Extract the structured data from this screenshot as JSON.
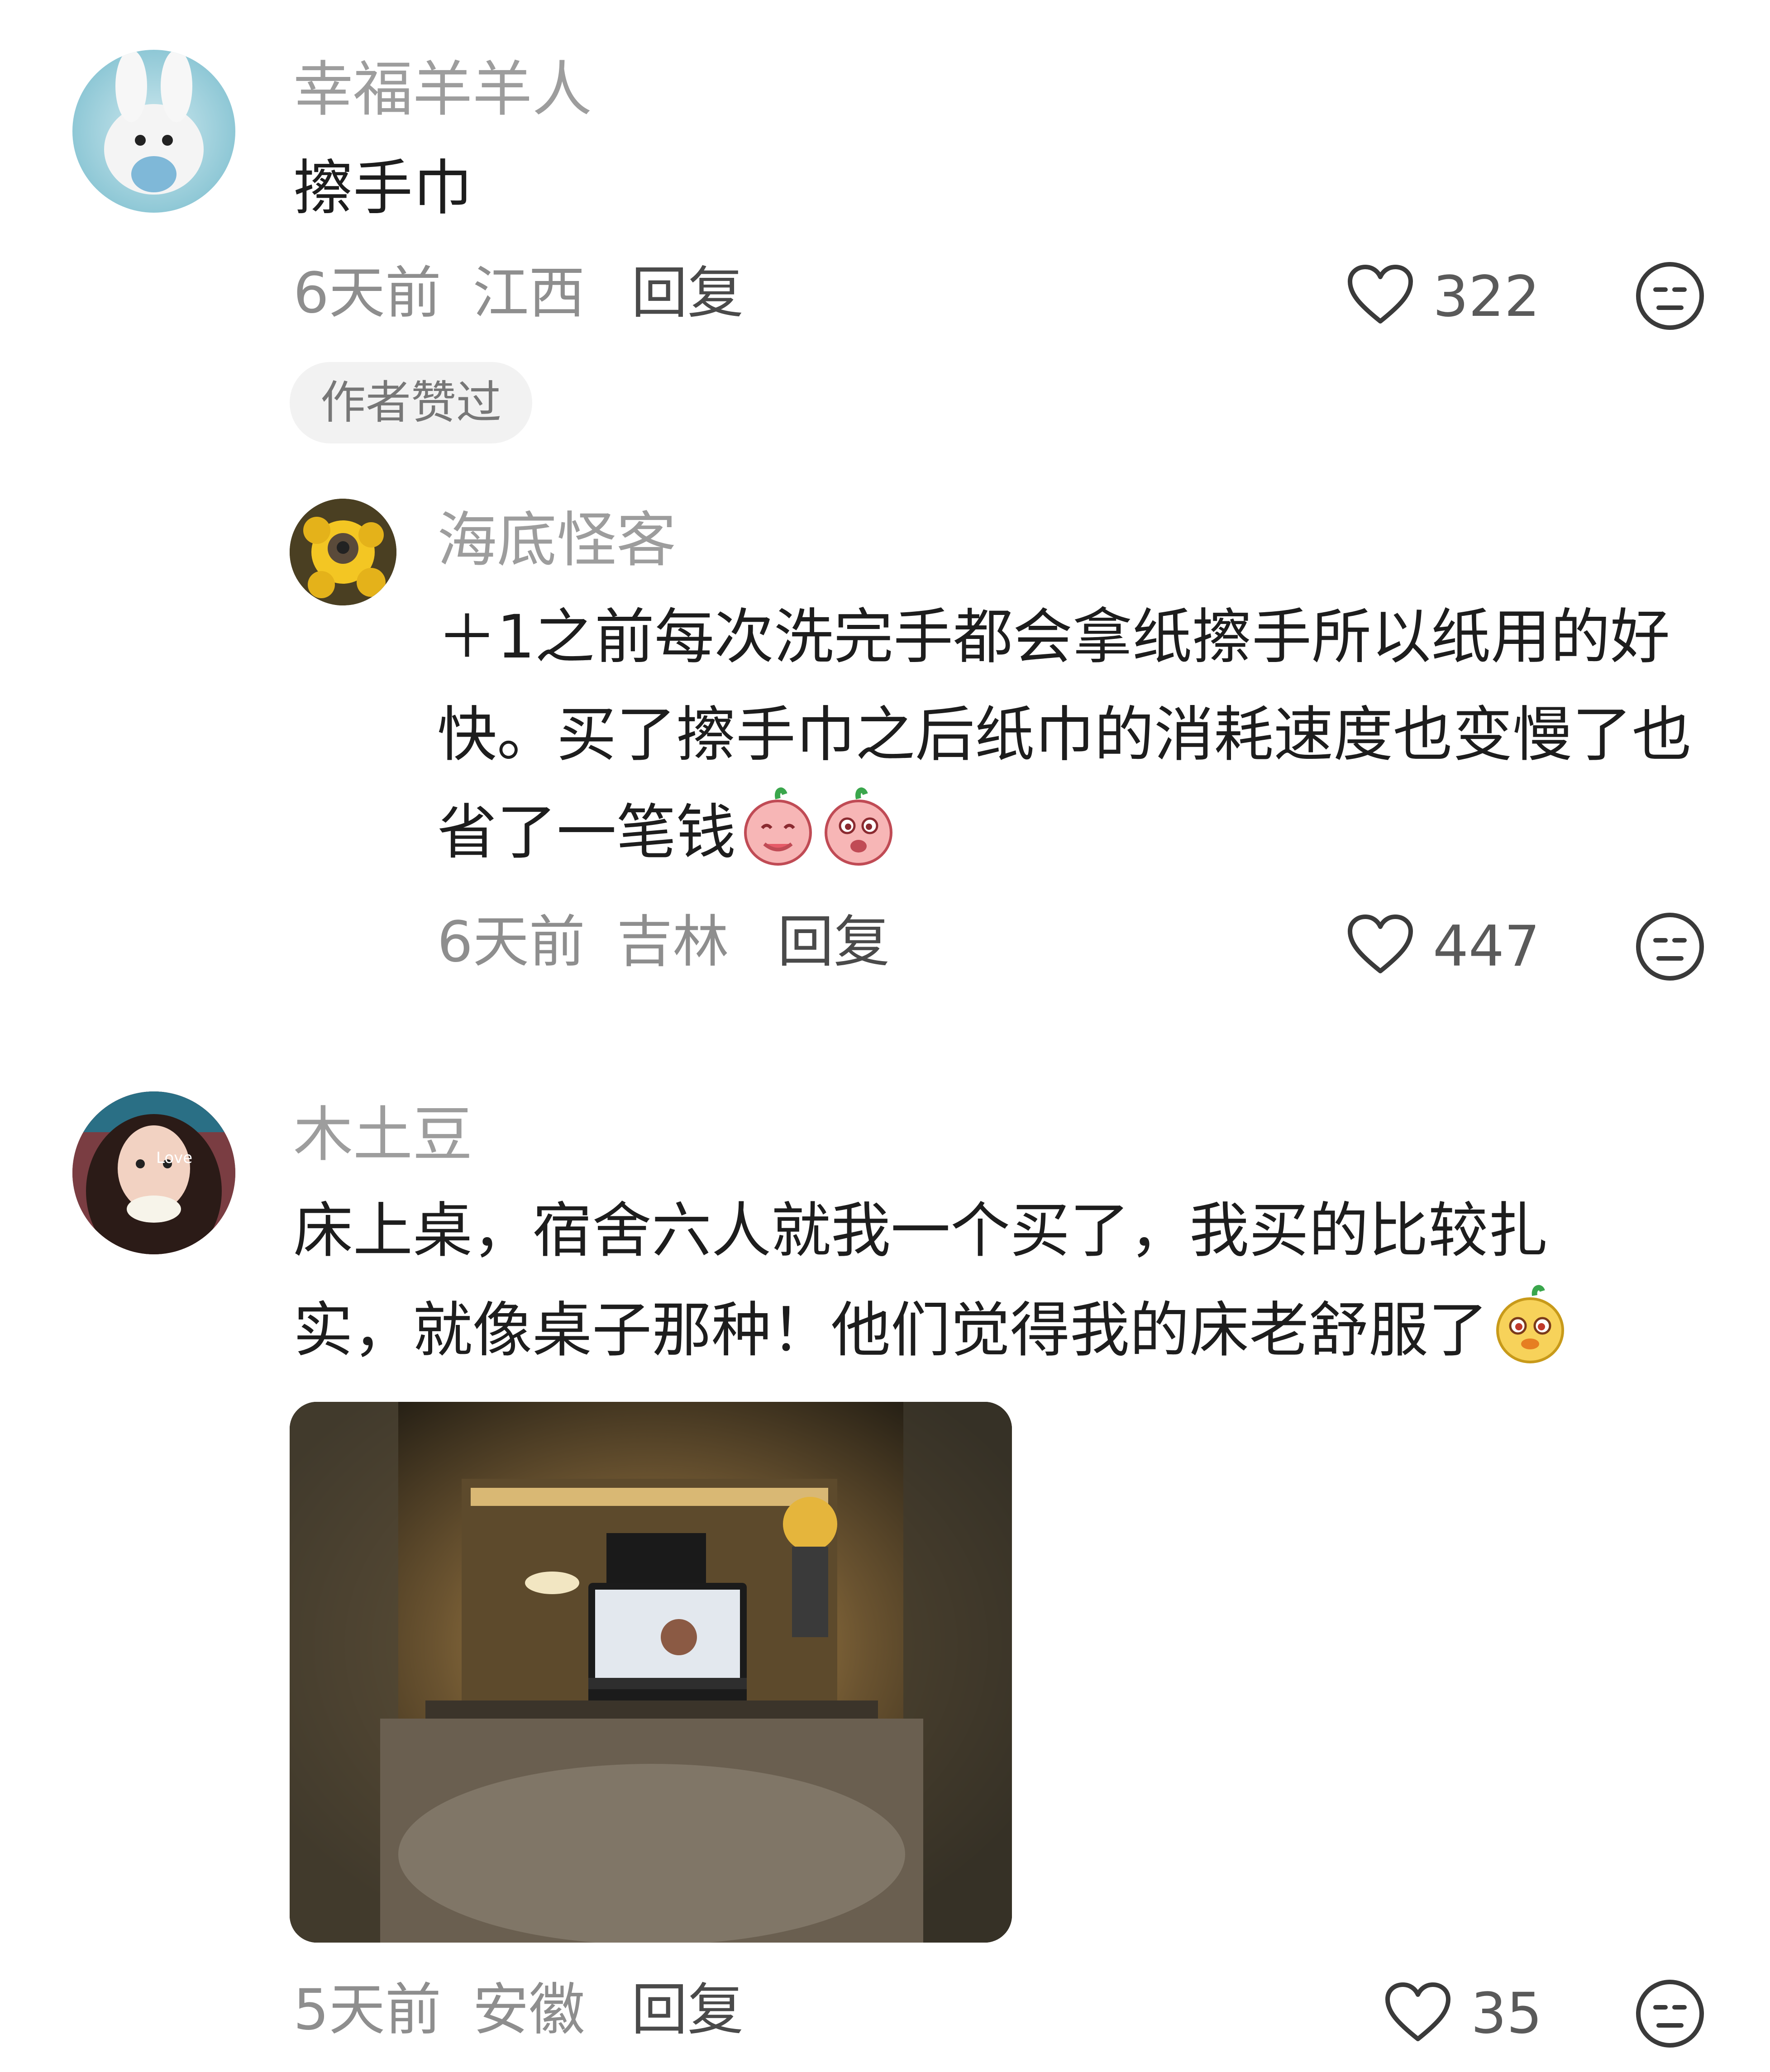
{
  "comments": [
    {
      "username": "幸福羊羊人",
      "text": "擦手巾",
      "time": "6天前",
      "location": "江西",
      "reply_label": "回复",
      "likes": "322",
      "badge": "作者赞过",
      "replies": [
        {
          "username": "海底怪客",
          "text": "＋1之前每次洗完手都会拿纸擦手所以纸用的好快。买了擦手巾之后纸巾的消耗速度也变慢了也省了一笔钱",
          "time": "6天前",
          "location": "吉林",
          "reply_label": "回复",
          "likes": "447"
        }
      ]
    },
    {
      "username": "木土豆",
      "text_line1": "床上桌，宿舍六人就我一个买了，我买的比较扎",
      "text_line2": "实，就像桌子那种！他们觉得我的床老舒服了",
      "avatar_overlay_text": "Love",
      "time": "5天前",
      "location": "安徽",
      "reply_label": "回复",
      "likes": "35"
    }
  ],
  "colors": {
    "username": "#9d9d9d",
    "text": "#1d1d1d",
    "meta": "#8e8e8e",
    "badge_bg": "#f2f2f2"
  },
  "icons": [
    "heart-outline-icon",
    "neutral-face-icon",
    "peach-emoji",
    "sticker-emoji"
  ]
}
